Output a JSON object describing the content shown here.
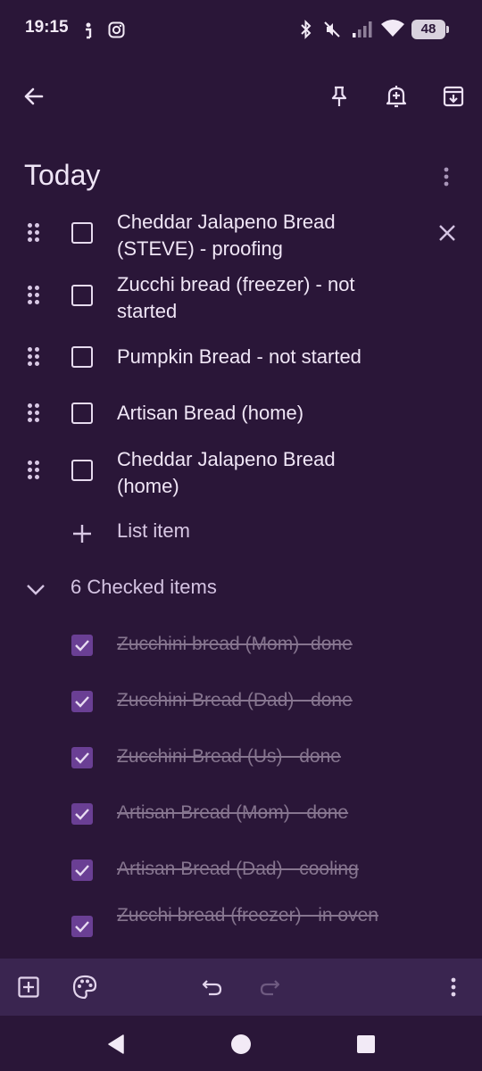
{
  "status": {
    "time": "19:15",
    "battery": "48"
  },
  "note": {
    "title": "Today",
    "unchecked_items": [
      {
        "text": "Cheddar Jalapeno Bread (STEVE) - proofing"
      },
      {
        "text": "Zucchi bread (freezer) - not started"
      },
      {
        "text": "Pumpkin Bread - not started"
      },
      {
        "text": "Artisan Bread (home)"
      },
      {
        "text": "Cheddar Jalapeno Bread (home)"
      }
    ],
    "add_item_label": "List item",
    "checked_header": "6 Checked items",
    "checked_items": [
      {
        "text": "Zucchini bread (Mom)- done"
      },
      {
        "text": "Zucchini Bread (Dad) - done"
      },
      {
        "text": "Zucchini Bread (Us) - done"
      },
      {
        "text": "Artisan Bread (Mom) - done"
      },
      {
        "text": "Artisan Bread (Dad) - cooling"
      },
      {
        "text": "Zucchi bread (freezer) - in oven"
      }
    ]
  },
  "colors": {
    "background": "#2a1638",
    "bottom_bar": "#3a2550",
    "checked_box": "#6a3f94",
    "text": "#f0e6f6",
    "checked_text": "#86758f"
  },
  "icons": {
    "toolbar": [
      "back-arrow-icon",
      "pin-icon",
      "add-reminder-icon",
      "archive-icon",
      "more-vert-icon"
    ],
    "bottom": [
      "add-box-icon",
      "palette-icon",
      "undo-icon",
      "redo-icon",
      "more-vert-icon"
    ],
    "nav": [
      "nav-back-icon",
      "nav-home-icon",
      "nav-recents-icon"
    ]
  }
}
